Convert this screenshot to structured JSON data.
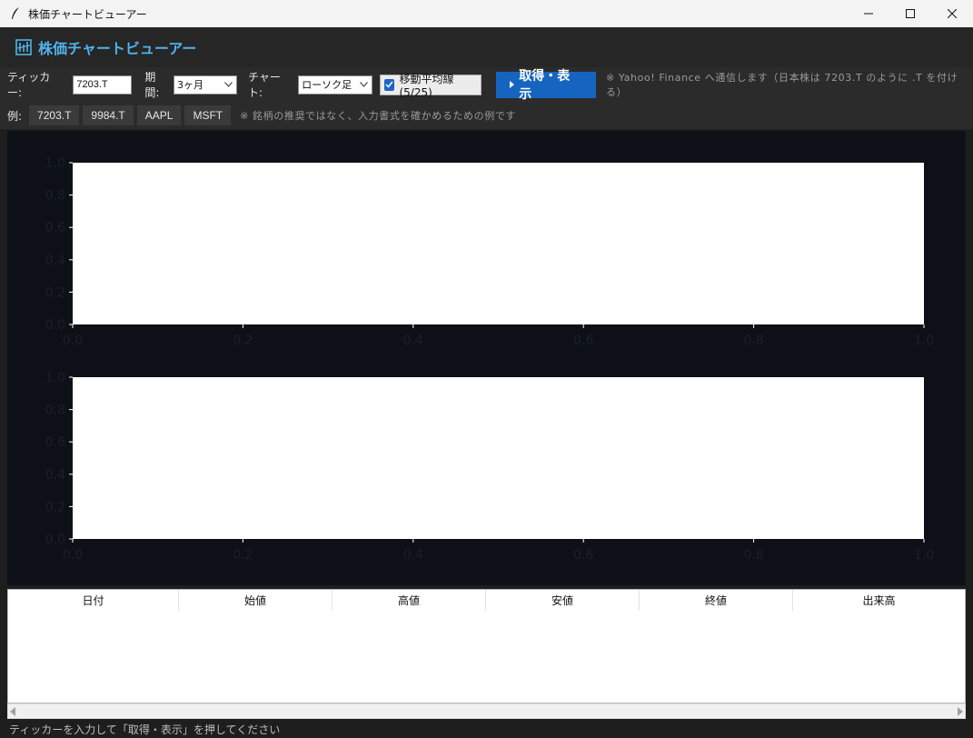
{
  "window": {
    "title": "株価チャートビューアー",
    "controls": [
      "minimize-icon",
      "maximize-icon",
      "close-icon"
    ]
  },
  "header": {
    "title": "株価チャートビューアー",
    "logo": "chart-icon",
    "accent": "#4fb3ea"
  },
  "toolbar": {
    "ticker_label": "ティッカー:",
    "ticker_value": "7203.T",
    "period_label": "期間:",
    "period_value": "3ヶ月",
    "chart_label": "チャート:",
    "chart_value": "ローソク足",
    "ma_label": "移動平均線(5/25)",
    "ma_checked": true,
    "fetch_label": "取得・表示",
    "note": "※ Yahoo! Finance へ通信します（日本株は 7203.T のように .T を付ける）",
    "button_color": "#1565c0"
  },
  "examples": {
    "label": "例:",
    "chips": [
      "7203.T",
      "9984.T",
      "AAPL",
      "MSFT"
    ],
    "note": "※ 銘柄の推奨ではなく、入力書式を確かめるための例です"
  },
  "chart_data": [
    {
      "type": "line",
      "title": "",
      "xlabel": "",
      "ylabel": "",
      "xlim": [
        0.0,
        1.0
      ],
      "ylim": [
        0.0,
        1.0
      ],
      "x_ticks": [
        "0.0",
        "0.2",
        "0.4",
        "0.6",
        "0.8",
        "1.0"
      ],
      "y_ticks": [
        "0.0",
        "0.2",
        "0.4",
        "0.6",
        "0.8",
        "1.0"
      ],
      "series": []
    },
    {
      "type": "bar",
      "title": "",
      "xlabel": "",
      "ylabel": "",
      "xlim": [
        0.0,
        1.0
      ],
      "ylim": [
        0.0,
        1.0
      ],
      "x_ticks": [
        "0.0",
        "0.2",
        "0.4",
        "0.6",
        "0.8",
        "1.0"
      ],
      "y_ticks": [
        "0.0",
        "0.2",
        "0.4",
        "0.6",
        "0.8",
        "1.0"
      ],
      "series": []
    }
  ],
  "table": {
    "columns": [
      "日付",
      "始値",
      "高値",
      "安値",
      "終値",
      "出来高"
    ],
    "rows": []
  },
  "status": {
    "text": "ティッカーを入力して「取得・表示」を押してください"
  }
}
